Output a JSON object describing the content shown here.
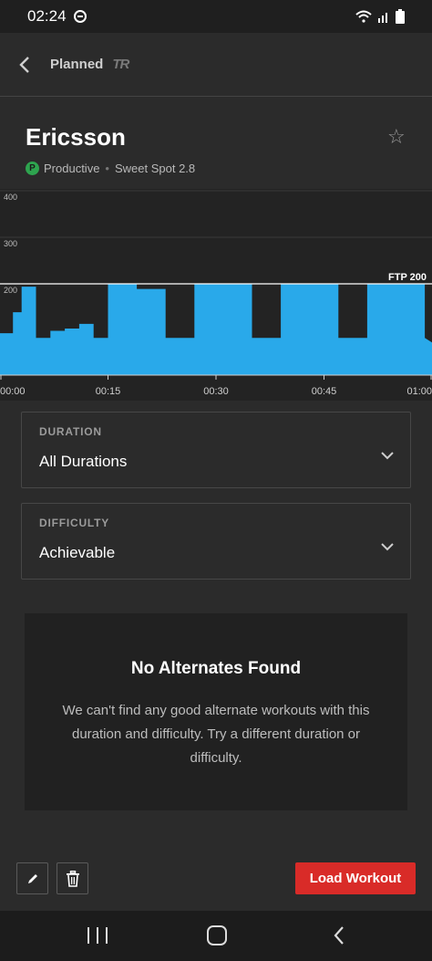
{
  "status_bar": {
    "time": "02:24"
  },
  "header": {
    "back_icon": "chevron-left-icon",
    "title": "Planned",
    "logo_text": "TR"
  },
  "workout": {
    "title": "Ericsson",
    "badge_letter": "P",
    "badge_color": "#2ea44f",
    "category": "Productive",
    "separator": "•",
    "zone_level": "Sweet Spot 2.8",
    "star_icon": "star-outline-icon"
  },
  "chart_data": {
    "type": "area",
    "title": "",
    "xlabel": "",
    "ylabel": "",
    "y_ticks": [
      "400",
      "300",
      "200"
    ],
    "x_ticks": [
      "00:00",
      "00:15",
      "00:30",
      "00:45",
      "01:00"
    ],
    "ylim": [
      0,
      400
    ],
    "xlim": [
      0,
      60
    ],
    "ftp_label": "FTP 200",
    "ftp_value": 200,
    "fill_color": "#29a9ea",
    "series": [
      {
        "x": [
          0,
          1.8,
          1.8,
          3,
          3,
          5,
          5,
          7,
          7,
          9,
          9,
          11,
          11,
          13,
          13,
          15,
          15,
          19,
          19,
          23,
          23,
          27,
          27,
          35,
          35,
          39,
          39,
          47,
          47,
          51,
          51,
          59,
          59,
          60
        ],
        "y": [
          90,
          90,
          135,
          135,
          190,
          190,
          80,
          80,
          95,
          95,
          100,
          100,
          110,
          110,
          80,
          80,
          195,
          195,
          185,
          185,
          80,
          80,
          195,
          195,
          80,
          80,
          195,
          195,
          80,
          80,
          195,
          195,
          80,
          70
        ]
      }
    ]
  },
  "duration": {
    "label": "DURATION",
    "value": "All Durations",
    "chevron_icon": "chevron-down-icon"
  },
  "difficulty": {
    "label": "DIFFICULTY",
    "value": "Achievable",
    "chevron_icon": "chevron-down-icon"
  },
  "empty_state": {
    "title": "No Alternates Found",
    "message": "We can't find any good alternate workouts with this duration and difficulty. Try a different duration or difficulty."
  },
  "actions": {
    "edit_icon": "pencil-icon",
    "delete_icon": "trash-icon",
    "load_label": "Load Workout",
    "load_color": "#d92b28"
  },
  "nav": {
    "recents_icon": "recents-icon",
    "home_icon": "home-icon",
    "back_icon": "back-icon"
  }
}
